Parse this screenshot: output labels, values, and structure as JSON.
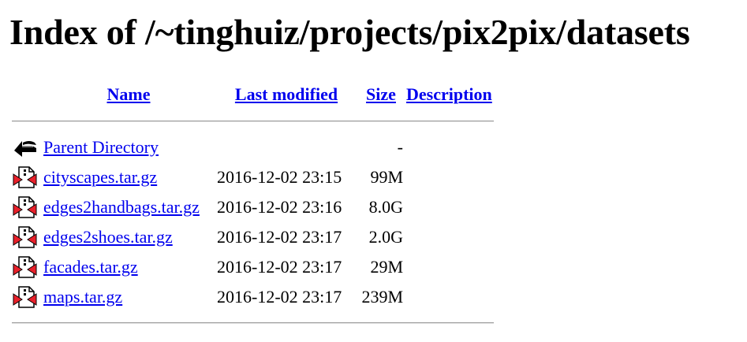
{
  "page": {
    "title": "Index of /~tinghuiz/projects/pix2pix/datasets"
  },
  "table": {
    "headers": {
      "name": "Name",
      "last_modified": "Last modified",
      "size": "Size",
      "description": "Description"
    },
    "parent": {
      "label": "Parent Directory",
      "size": "-",
      "icon": "back-arrow-icon"
    },
    "rows": [
      {
        "name": "cityscapes.tar.gz",
        "modified": "2016-12-02 23:15",
        "size": "99M",
        "icon": "compressed-file-icon"
      },
      {
        "name": "edges2handbags.tar.gz",
        "modified": "2016-12-02 23:16",
        "size": "8.0G",
        "icon": "compressed-file-icon"
      },
      {
        "name": "edges2shoes.tar.gz",
        "modified": "2016-12-02 23:17",
        "size": "2.0G",
        "icon": "compressed-file-icon"
      },
      {
        "name": "facades.tar.gz",
        "modified": "2016-12-02 23:17",
        "size": "29M",
        "icon": "compressed-file-icon"
      },
      {
        "name": "maps.tar.gz",
        "modified": "2016-12-02 23:17",
        "size": "239M",
        "icon": "compressed-file-icon"
      }
    ]
  },
  "colors": {
    "link": "#0000ee",
    "text": "#000000",
    "icon_red": "#e8202a"
  }
}
